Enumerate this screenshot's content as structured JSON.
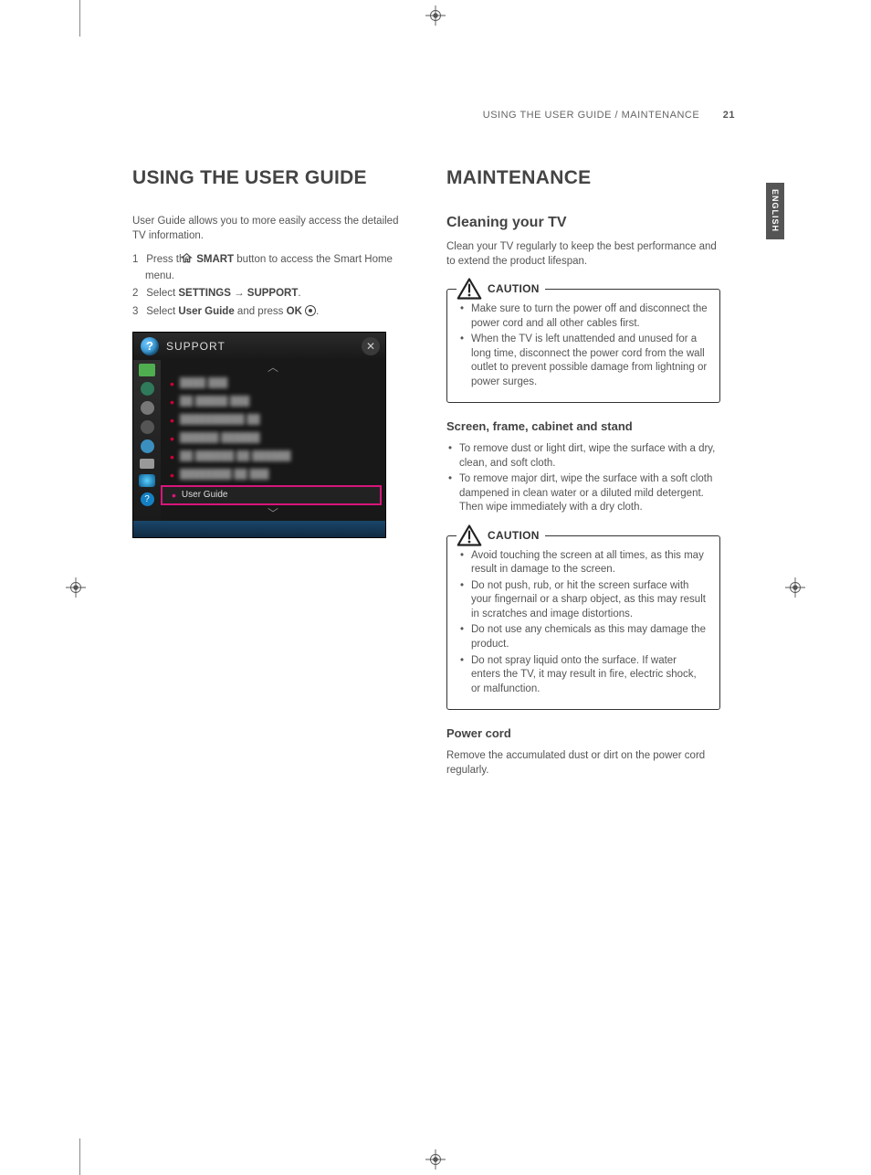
{
  "header": {
    "section": "USING THE USER GUIDE / MAINTENANCE",
    "page_number": "21"
  },
  "language_tab": "ENGLISH",
  "left": {
    "title": "USING THE USER GUIDE",
    "intro": "User Guide allows you to more easily access the detailed TV information.",
    "steps": {
      "s1_pre": "Press the ",
      "s1_bold": "SMART",
      "s1_post": " button to access the Smart Home menu.",
      "s2_pre": "Select ",
      "s2_b1": "SETTINGS",
      "s2_arrow": " → ",
      "s2_b2": "SUPPORT",
      "s2_post": ".",
      "s3_pre": "Select ",
      "s3_b1": "User Guide",
      "s3_mid": " and press ",
      "s3_b2": "OK",
      "s3_post": "."
    },
    "support_window": {
      "title": "SUPPORT",
      "selected_item": "User Guide"
    }
  },
  "right": {
    "title": "MAINTENANCE",
    "cleaning_heading": "Cleaning your TV",
    "cleaning_intro": "Clean your TV regularly to keep the best performance and to extend the product lifespan.",
    "caution1_label": "CAUTION",
    "caution1_items": [
      "Make sure to turn the power off and disconnect the power cord and all other cables first.",
      "When the TV is left unattended and unused for a long time, disconnect the power cord from the wall outlet to prevent possible damage from lightning or power surges."
    ],
    "screen_heading": "Screen, frame, cabinet and stand",
    "screen_items": [
      "To remove dust or light dirt, wipe the surface with a dry, clean, and soft cloth.",
      "To remove major dirt, wipe the surface with a soft cloth dampened in clean water or a diluted mild detergent. Then wipe immediately with a dry cloth."
    ],
    "caution2_label": "CAUTION",
    "caution2_items": [
      "Avoid touching the screen at all times, as this may result in damage to the screen.",
      "Do not push, rub, or hit the screen surface with your fingernail or a sharp object, as this may result in scratches and image distortions.",
      "Do not use any chemicals as this may damage the product.",
      "Do not spray liquid onto the surface. If water enters the TV, it may result in fire, electric shock, or malfunction."
    ],
    "powercord_heading": "Power cord",
    "powercord_text": "Remove the accumulated dust or dirt on the power cord regularly."
  }
}
